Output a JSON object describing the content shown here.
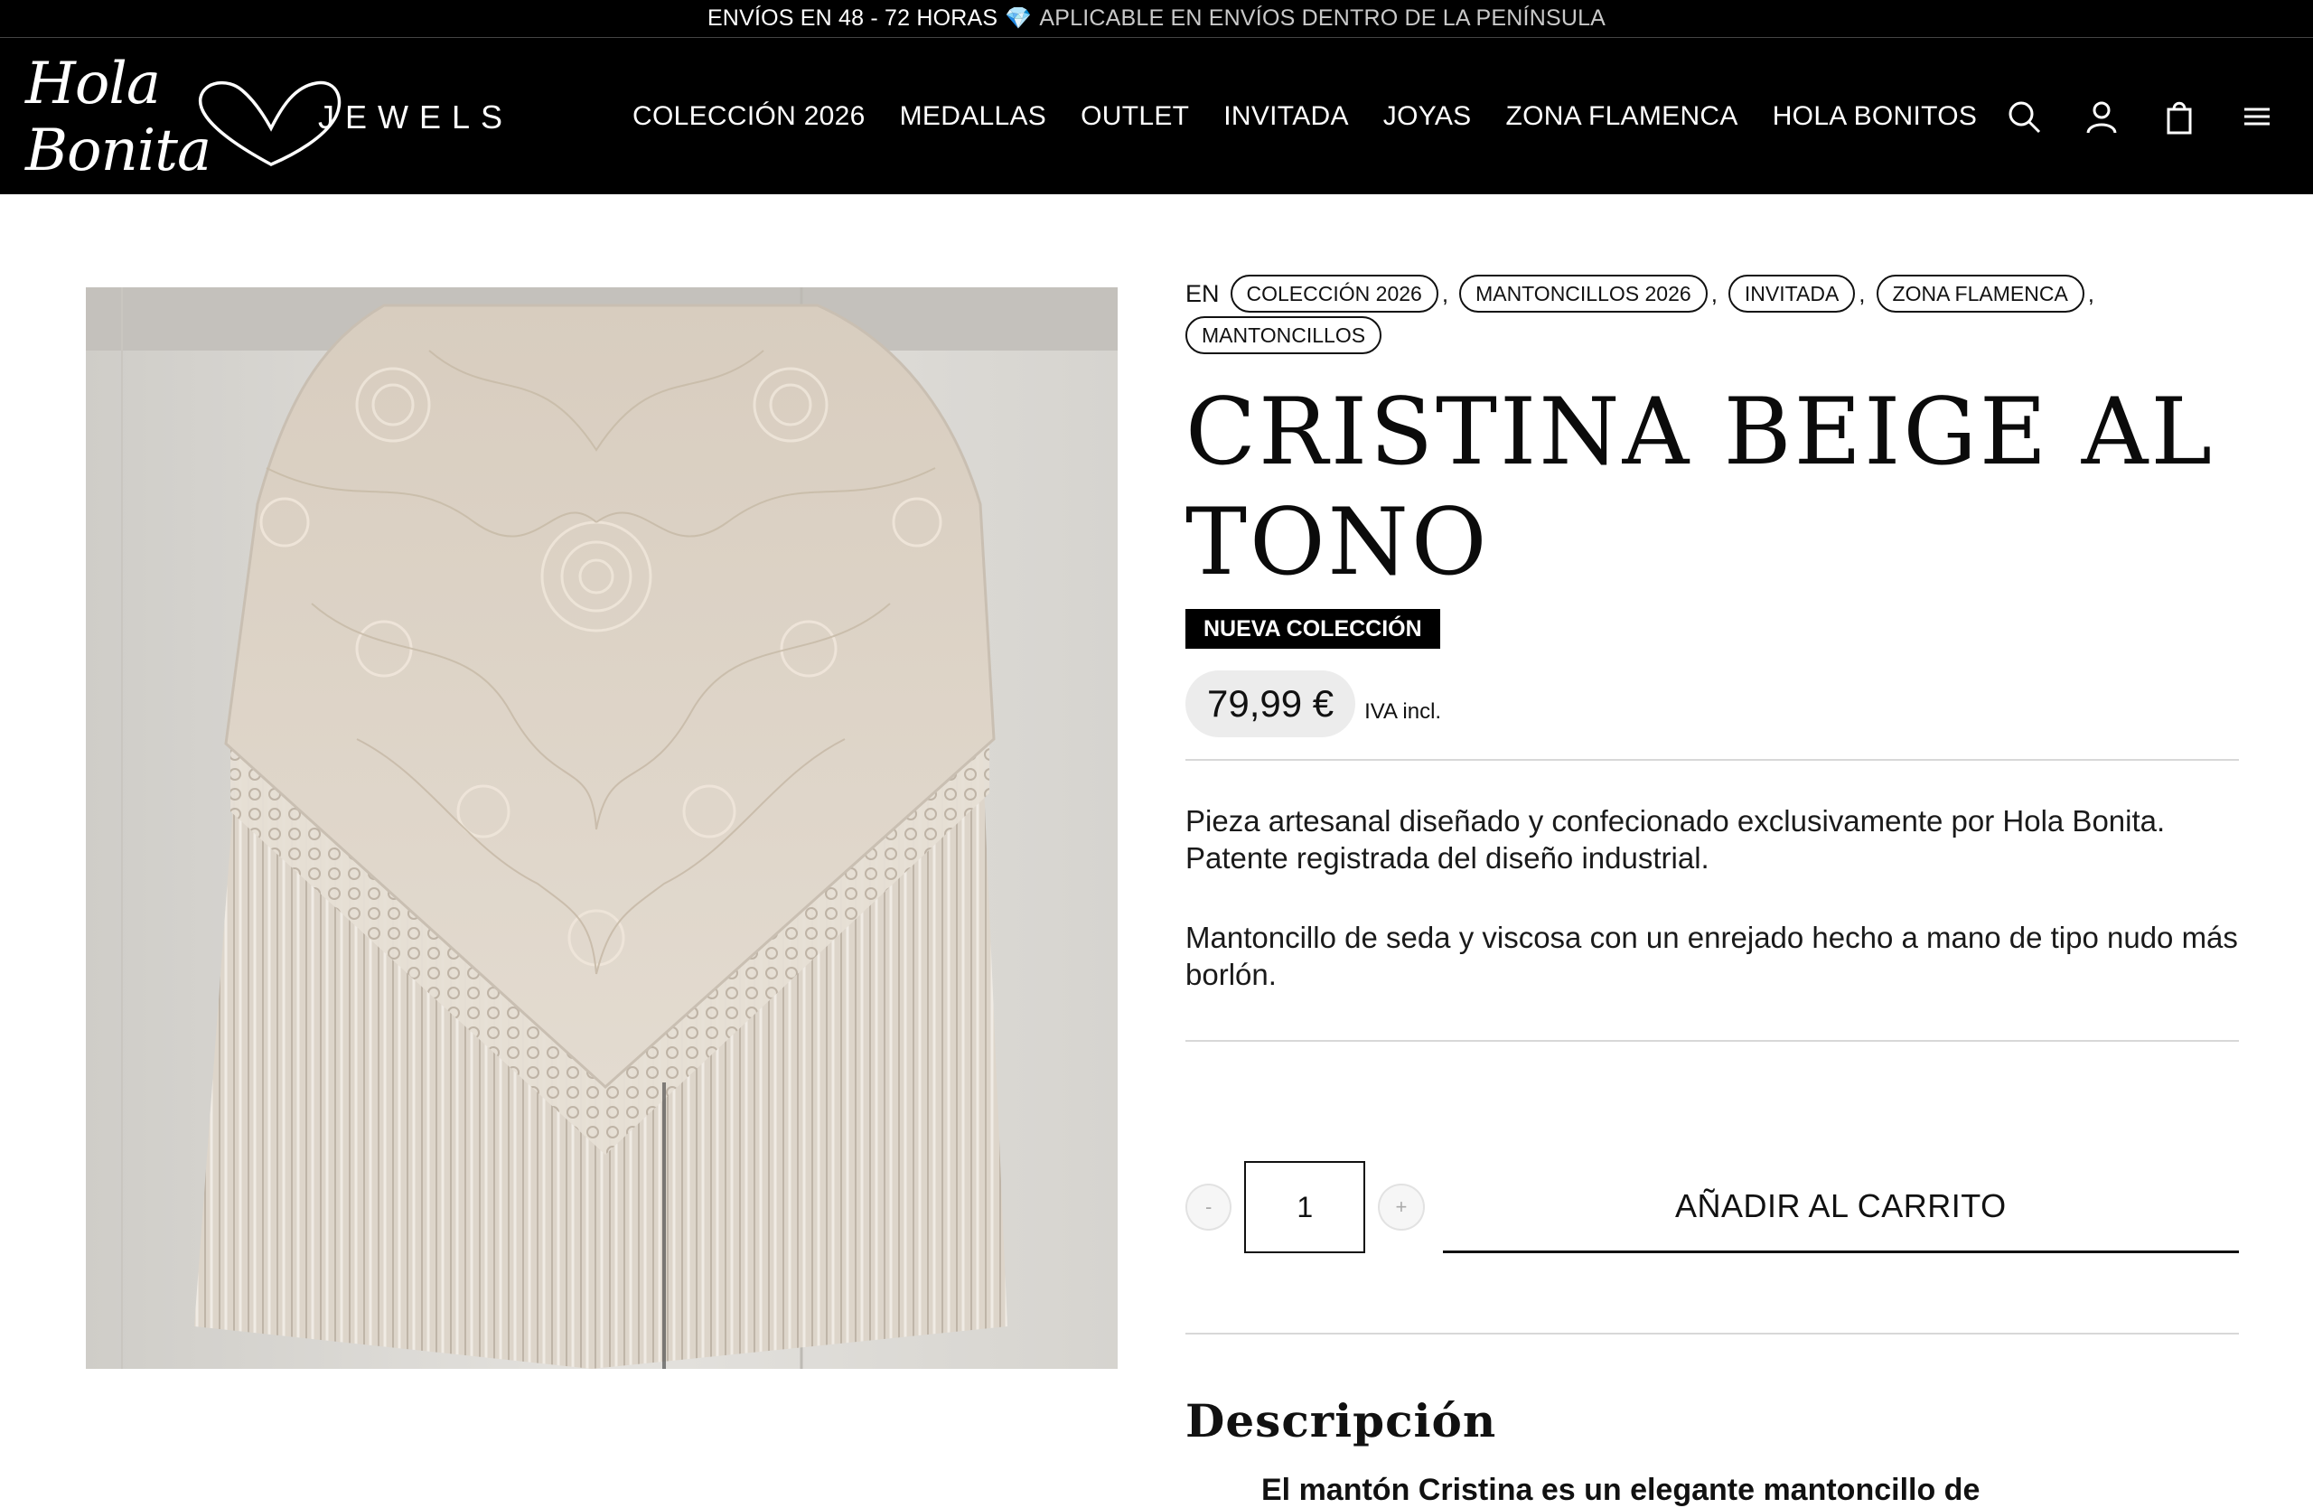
{
  "announcement": {
    "left": "ENVÍOS EN 48 - 72 HORAS",
    "gem": "💎",
    "right": "APLICABLE EN ENVÍOS DENTRO DE LA PENÍNSULA"
  },
  "brand": {
    "script": "Hola Bonita",
    "jewels": "JEWELS"
  },
  "nav": {
    "items": [
      "COLECCIÓN 2026",
      "MEDALLAS",
      "OUTLET",
      "INVITADA",
      "JOYAS",
      "ZONA FLAMENCA",
      "HOLA BONITOS"
    ]
  },
  "header_icons": [
    "search-icon",
    "account-icon",
    "bag-icon",
    "menu-icon"
  ],
  "product": {
    "categories_prefix": "EN",
    "categories": [
      "COLECCIÓN 2026",
      "MANTONCILLOS 2026",
      "INVITADA",
      "ZONA FLAMENCA",
      "MANTONCILLOS"
    ],
    "title_line1": "CRISTINA BEIGE AL",
    "title_line2": "TONO",
    "badge": "NUEVA COLECCIÓN",
    "price": "79,99 €",
    "tax_note": "IVA incl.",
    "description_p1": "Pieza artesanal diseñado y confecionado exclusivamente por Hola Bonita. Patente registrada del diseño industrial.",
    "description_p2": "Mantoncillo de seda y viscosa con un enrejado hecho a mano de tipo nudo más borlón.",
    "quantity": {
      "minus": "-",
      "value": "1",
      "plus": "+"
    },
    "add_to_cart": "AÑADIR AL CARRITO",
    "section_title": "Descripción",
    "section_cut_text": "El mantón Cristina es un elegante mantoncillo de"
  },
  "colors": {
    "header_bg": "#000000",
    "accent": "#111111",
    "price_bg": "#ececec"
  }
}
